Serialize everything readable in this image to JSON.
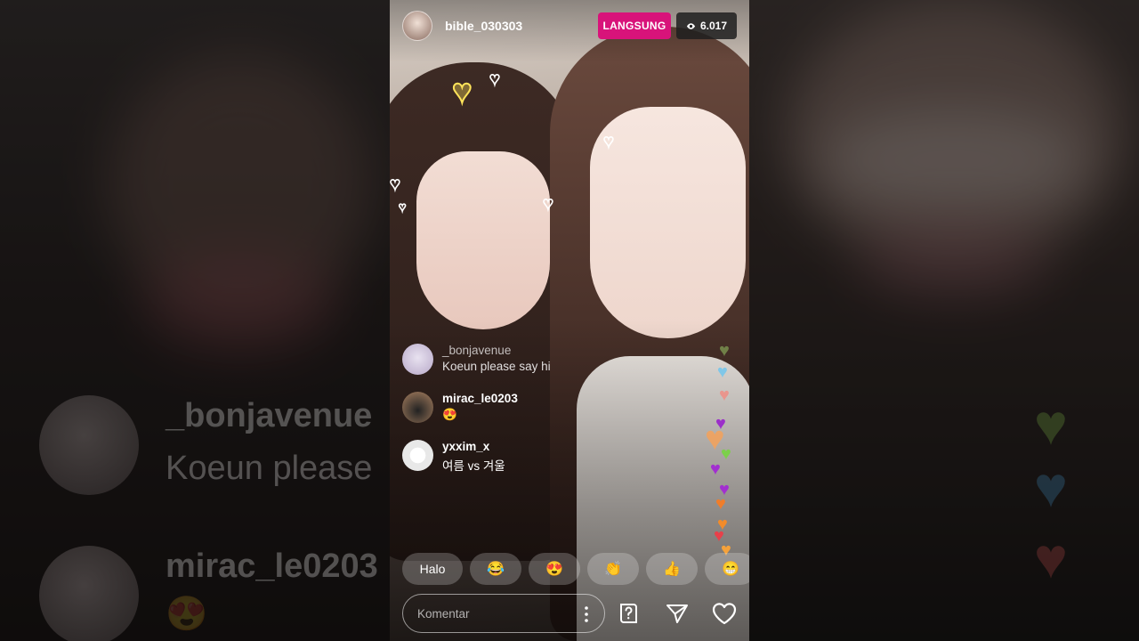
{
  "stream": {
    "host_username": "bible_030303",
    "live_label": "LANGSUNG",
    "viewer_count": "6.017"
  },
  "comments": [
    {
      "username": "_bonjavenue",
      "text": "Koeun please say hi"
    },
    {
      "username": "mirac_le0203",
      "text": "😍"
    },
    {
      "username": "yxxim_x",
      "text": "여름 vs 겨울"
    }
  ],
  "quick_reactions": [
    {
      "label": "Halo",
      "kind": "text"
    },
    {
      "label": "😂",
      "kind": "emoji"
    },
    {
      "label": "😍",
      "kind": "emoji"
    },
    {
      "label": "👏",
      "kind": "emoji"
    },
    {
      "label": "👍",
      "kind": "emoji"
    },
    {
      "label": "😁",
      "kind": "emoji"
    }
  ],
  "composer": {
    "placeholder": "Komentar"
  },
  "background_ghost": {
    "username_1": "_bonjavenue",
    "text_1": "Koeun please",
    "username_2": "mirac_le0203",
    "text_2": "😍"
  },
  "icons": {
    "viewer": "eye-icon",
    "more": "more-vertical-icon",
    "question": "question-box-icon",
    "share": "send-icon",
    "like": "heart-icon"
  },
  "colors": {
    "live_badge": "#d8137a",
    "viewer_badge": "#1e1e1e"
  }
}
